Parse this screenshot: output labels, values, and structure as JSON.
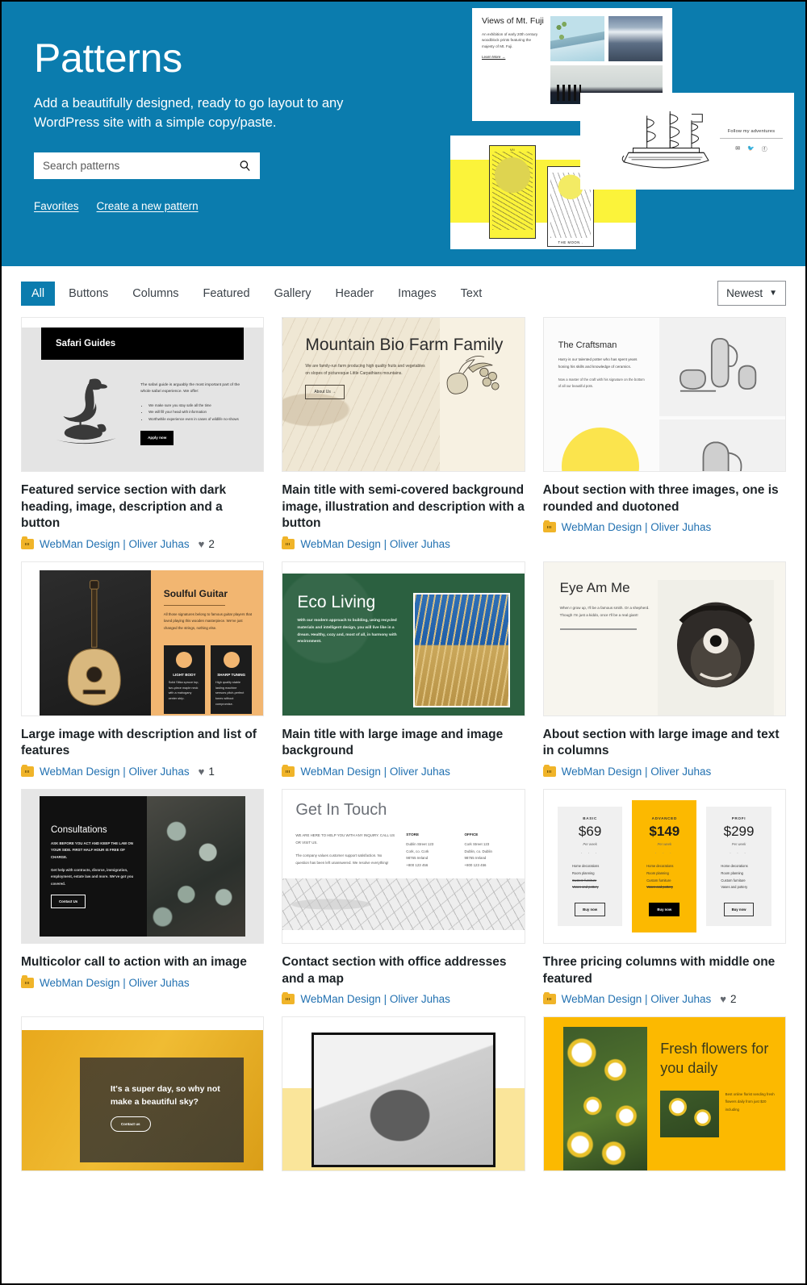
{
  "hero": {
    "title": "Patterns",
    "subtitle": "Add a beautifully designed, ready to go layout to any WordPress site with a simple copy/paste.",
    "search_placeholder": "Search patterns",
    "search_value": "",
    "search_icon": "search-icon",
    "links": [
      {
        "label": "Favorites"
      },
      {
        "label": "Create a new pattern"
      }
    ],
    "background_color": "#0b7cae",
    "artwork": {
      "fuji": {
        "heading": "Views of Mt. Fuji",
        "body": "An exhibition of early 20th century woodblock prints featuring the majesty of Mt. Fuji.",
        "link": "Learn More →"
      },
      "ship": {
        "heading": "Follow my adventures",
        "icons": [
          "mail-icon",
          "twitter-icon",
          "facebook-icon"
        ]
      },
      "tarot": {
        "card_one_label": "VII",
        "card_two_label": "THE MOON ."
      }
    }
  },
  "toolbar": {
    "tabs": [
      {
        "label": "All",
        "active": true
      },
      {
        "label": "Buttons",
        "active": false
      },
      {
        "label": "Columns",
        "active": false
      },
      {
        "label": "Featured",
        "active": false
      },
      {
        "label": "Gallery",
        "active": false
      },
      {
        "label": "Header",
        "active": false
      },
      {
        "label": "Images",
        "active": false
      },
      {
        "label": "Text",
        "active": false
      }
    ],
    "sort": {
      "selected": "Newest",
      "chevron_icon": "chevron-down-icon"
    },
    "active_tab_color": "#0b7cae"
  },
  "patterns": [
    {
      "title": "Featured service section with dark heading, image, description and a button",
      "author": "WebMan Design | Oliver Juhas",
      "likes": "2",
      "preview": {
        "heading": "Safari Guides",
        "paragraph": "The safari guide is arguably the most important part of the whole safari experience. We offer:",
        "bullets": [
          "We make sure you stay safe all the time",
          "We will fill your head with information",
          "Worthwhile experience even in cases of wildlife no-shows"
        ],
        "button": "Apply now"
      }
    },
    {
      "title": "Main title with semi-covered background image, illustration and description with a button",
      "author": "WebMan Design | Oliver Juhas",
      "likes": "",
      "preview": {
        "heading": "Mountain Bio Farm Family",
        "paragraph": "We are family-run farm producing high quality fruits and vegetables on slopes of picturesque Little Carpathians mountains.",
        "button": "About Us →"
      }
    },
    {
      "title": "About section with three images, one is rounded and duotoned",
      "author": "WebMan Design | Oliver Juhas",
      "likes": "",
      "preview": {
        "heading": "The Craftsman",
        "paragraph": "Harry is our talented potter who has spent years honing his skills and knowledge of ceramics.",
        "paragraph2": "Now a master of the craft with his signature on the bottom of all our beautiful pots."
      }
    },
    {
      "title": "Large image with description and list of features",
      "author": "WebMan Design | Oliver Juhas",
      "likes": "1",
      "preview": {
        "heading": "Soulful Guitar",
        "paragraph": "All those signatures belong to famous guitar players that loved playing this wooden masterpiece. We've just changed the strings, nothing else.",
        "features": [
          {
            "title": "LIGHT BODY",
            "body": "Solid Sitka spruce top, two-piece maple neck with a mahogany center strip."
          },
          {
            "title": "SHARP TUNING",
            "body": "High quality stable lasting machine sensors pitch-perfect tones without compromise."
          }
        ]
      }
    },
    {
      "title": "Main title with large image and image background",
      "author": "WebMan Design | Oliver Juhas",
      "likes": "",
      "preview": {
        "heading": "Eco Living",
        "paragraph": "With our modern approach to building, using recycled materials and intelligent design, you will live like in a dream. Healthy, cozy and, most of all, in harmony with environment."
      }
    },
    {
      "title": "About section with large image and text in columns",
      "author": "WebMan Design | Oliver Juhas",
      "likes": "",
      "preview": {
        "heading": "Eye Am Me",
        "paragraph": "When I grow up, I'll be a famous smith. Or a shepherd. Though I'm just a kiddo, once I'll be a real giant!"
      }
    },
    {
      "title": "Multicolor call to action with an image",
      "author": "WebMan Design | Oliver Juhas",
      "likes": "",
      "preview": {
        "heading": "Consultations",
        "paragraph": "ASK BEFORE YOU ACT AND KEEP THE LAW ON YOUR SIDE. FIRST HALF HOUR IS FREE OF CHARGE.",
        "paragraph2": "Get help with contracts, divorce, immigration, employment, estate law and more. We've got you covered.",
        "button": "Contact Us"
      }
    },
    {
      "title": "Contact section with office addresses and a map",
      "author": "WebMan Design | Oliver Juhas",
      "likes": "",
      "preview": {
        "heading": "Get In Touch",
        "paragraph": "WE ARE HERE TO HELP YOU WITH ANY INQUIRY. CALL US OR VISIT US.",
        "paragraph2": "The company values customer support satisfaction. No question has been left unanswered. We resolve everything!",
        "offices": [
          {
            "label": "STORE",
            "lines": [
              "Dublin Street 123",
              "Cork, co. Cork",
              "98765 Ireland",
              "+800 123 456"
            ]
          },
          {
            "label": "OFFICE",
            "lines": [
              "Cork Street 123",
              "Dublin, co. Dublin",
              "98765 Ireland",
              "+800 123 456"
            ]
          }
        ]
      }
    },
    {
      "title": "Three pricing columns with middle one featured",
      "author": "WebMan Design | Oliver Juhas",
      "likes": "2",
      "preview": {
        "plans": [
          {
            "name": "BASIC",
            "price": "$69",
            "period": "Per week",
            "features": [
              "Home decorations",
              "Room planning",
              "Custom furniture",
              "Vases and pottery"
            ],
            "struck": [
              2,
              3
            ],
            "button": "Buy now",
            "featured": false
          },
          {
            "name": "ADVANCED",
            "price": "$149",
            "period": "Per week",
            "features": [
              "Home decorations",
              "Room planning",
              "Custom furniture",
              "Vases and pottery"
            ],
            "struck": [
              3
            ],
            "button": "Buy now",
            "featured": true
          },
          {
            "name": "PROFI",
            "price": "$299",
            "period": "Per week",
            "features": [
              "Home decorations",
              "Room planning",
              "Custom furniture",
              "Vases and pottery"
            ],
            "struck": [],
            "button": "Buy now",
            "featured": false
          }
        ]
      }
    },
    {
      "title": "",
      "author": "",
      "likes": "",
      "preview": {
        "heading": "It's a super day, so why not make a beautiful sky?",
        "button": "Contact us"
      }
    },
    {
      "title": "",
      "author": "",
      "likes": "",
      "preview": {}
    },
    {
      "title": "",
      "author": "",
      "likes": "",
      "preview": {
        "heading": "Fresh flowers for you daily",
        "paragraph": "Best online florist sending fresh flowers daily from just $20 including"
      }
    }
  ]
}
